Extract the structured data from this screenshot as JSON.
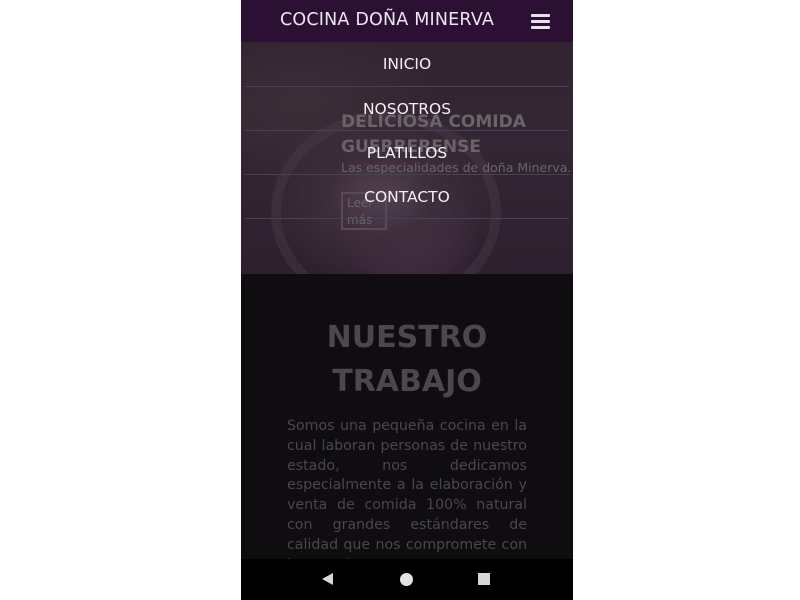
{
  "app": {
    "brand": "COCINA DOÑA MINERVA"
  },
  "menu": {
    "items": [
      {
        "label": "INICIO"
      },
      {
        "label": "NOSOTROS"
      },
      {
        "label": "PLATILLOS"
      },
      {
        "label": "CONTACTO"
      }
    ]
  },
  "hero": {
    "title": "DELICIOSA COMIDA GUERRERENSE",
    "subtitle": "Las especialidades de doña Minerva.",
    "button_label": "Leer más"
  },
  "section": {
    "title": "NUESTRO TRABAJO",
    "body": "Somos una pequeña cocina en la cual laboran personas de nuestro estado, nos dedicamos especialmente a la elaboración y venta de comida 100% natural con grandes estándares de calidad que nos compromete con la zona Costa"
  },
  "icons": {
    "menu": "hamburger-menu-icon",
    "back": "back-triangle-icon",
    "home": "home-circle-icon",
    "recents": "recents-square-icon"
  },
  "colors": {
    "topbar": "#2b1033",
    "background": "#0f0d10",
    "menu_text": "#f4f1f5",
    "divider": "#3e4658"
  }
}
